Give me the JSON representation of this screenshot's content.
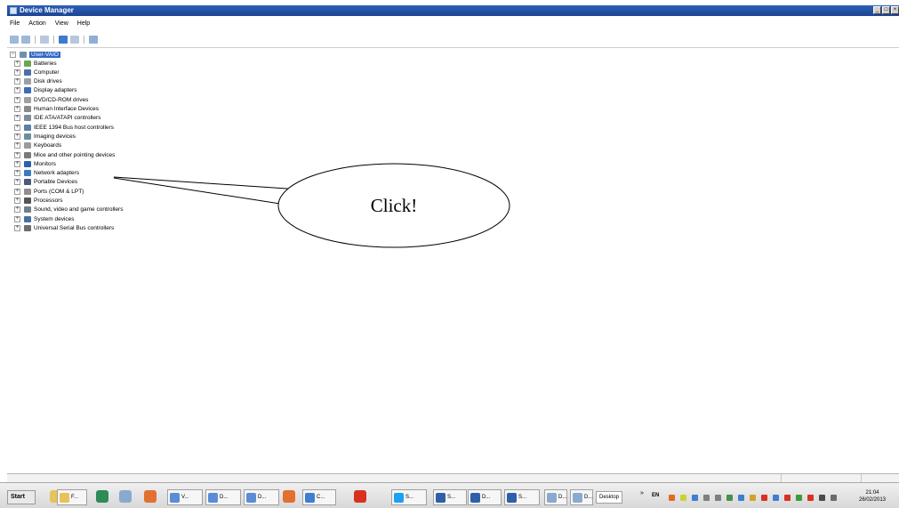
{
  "window": {
    "title": "Device Manager",
    "controls": [
      "_",
      "□",
      "×"
    ]
  },
  "menu": {
    "file": "File",
    "action": "Action",
    "view": "View",
    "help": "Help"
  },
  "tree": {
    "root": "User-VAIO",
    "items": [
      {
        "label": "Batteries",
        "icon_color": "#6aa84f"
      },
      {
        "label": "Computer",
        "icon_color": "#4a6fa5"
      },
      {
        "label": "Disk drives",
        "icon_color": "#9aa0a6"
      },
      {
        "label": "Display adapters",
        "icon_color": "#3d6cb9"
      },
      {
        "label": "DVD/CD-ROM drives",
        "icon_color": "#a0a0a0"
      },
      {
        "label": "Human Interface Devices",
        "icon_color": "#8a8a8a"
      },
      {
        "label": "IDE ATA/ATAPI controllers",
        "icon_color": "#7f8c9a"
      },
      {
        "label": "IEEE 1394 Bus host controllers",
        "icon_color": "#5c7fa8"
      },
      {
        "label": "Imaging devices",
        "icon_color": "#6b8e9e"
      },
      {
        "label": "Keyboards",
        "icon_color": "#9a9a9a"
      },
      {
        "label": "Mice and other pointing devices",
        "icon_color": "#7a7a7a"
      },
      {
        "label": "Monitors",
        "icon_color": "#2f5fa8"
      },
      {
        "label": "Network adapters",
        "icon_color": "#3b7bbf"
      },
      {
        "label": "Portable Devices",
        "icon_color": "#4c5a7a"
      },
      {
        "label": "Ports (COM & LPT)",
        "icon_color": "#8f8f8f"
      },
      {
        "label": "Processors",
        "icon_color": "#555555"
      },
      {
        "label": "Sound, video and game controllers",
        "icon_color": "#6f7f8f"
      },
      {
        "label": "System devices",
        "icon_color": "#4a6fa5"
      },
      {
        "label": "Universal Serial Bus controllers",
        "icon_color": "#6d6d6d"
      }
    ]
  },
  "callout": {
    "text": "Click!"
  },
  "taskbar": {
    "start": "Start",
    "tasks": [
      {
        "label": "F...",
        "icon_color": "#e8c15a"
      },
      {
        "label": "V...",
        "icon_color": "#5b8dd6"
      },
      {
        "label": "D...",
        "icon_color": "#5b8dd6"
      },
      {
        "label": "D...",
        "icon_color": "#5b8dd6"
      },
      {
        "label": "C...",
        "icon_color": "#3d7fd1"
      },
      {
        "label": "S...",
        "icon_color": "#1da1f2"
      },
      {
        "label": "S...",
        "icon_color": "#2f5fa8"
      },
      {
        "label": "D...",
        "icon_color": "#2f5fa8"
      },
      {
        "label": "S...",
        "icon_color": "#2f5fa8"
      },
      {
        "label": "D...",
        "icon_color": "#8aa9cf"
      },
      {
        "label": "D...",
        "icon_color": "#8aa9cf"
      }
    ],
    "desktop": "Desktop",
    "chevron": "»",
    "language": "EN",
    "time": "21:04",
    "date": "26/02/2013"
  }
}
